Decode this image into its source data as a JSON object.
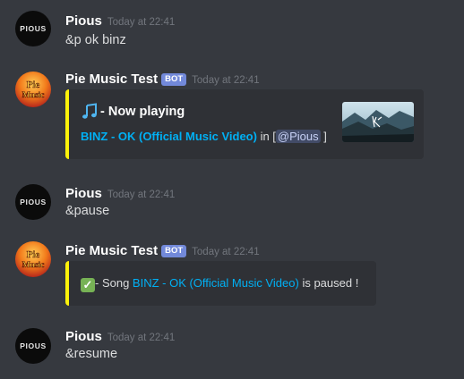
{
  "colors": {
    "background": "#36393f",
    "embed_bg": "#2f3136",
    "embed_accent": "#fdf20a",
    "link": "#00b0f4",
    "bot_badge": "#7289da",
    "timestamp": "#72767d"
  },
  "messages": [
    {
      "author": "Pious",
      "avatar_text": "PIOUS",
      "timestamp": "Today at 22:41",
      "content": "&p ok binz"
    },
    {
      "author": "Pie Music Test",
      "badge": "BOT",
      "avatar_text": "Pie Music",
      "timestamp": "Today at 22:41",
      "embed": {
        "icon": "musical-note-icon",
        "title": "- Now playing",
        "song_link": "BINZ - OK (Official Music Video)",
        "in_text": " in [",
        "mention": "@Pious",
        "close_bracket": "]"
      }
    },
    {
      "author": "Pious",
      "avatar_text": "PIOUS",
      "timestamp": "Today at 22:41",
      "content": "&pause"
    },
    {
      "author": "Pie Music Test",
      "badge": "BOT",
      "avatar_text": "Pie Music",
      "timestamp": "Today at 22:41",
      "embed": {
        "icon": "check-mark-icon",
        "prefix": "- Song ",
        "song_link": "BINZ - OK (Official Music Video)",
        "suffix": " is paused !"
      }
    },
    {
      "author": "Pious",
      "avatar_text": "PIOUS",
      "timestamp": "Today at 22:41",
      "content": "&resume"
    }
  ]
}
